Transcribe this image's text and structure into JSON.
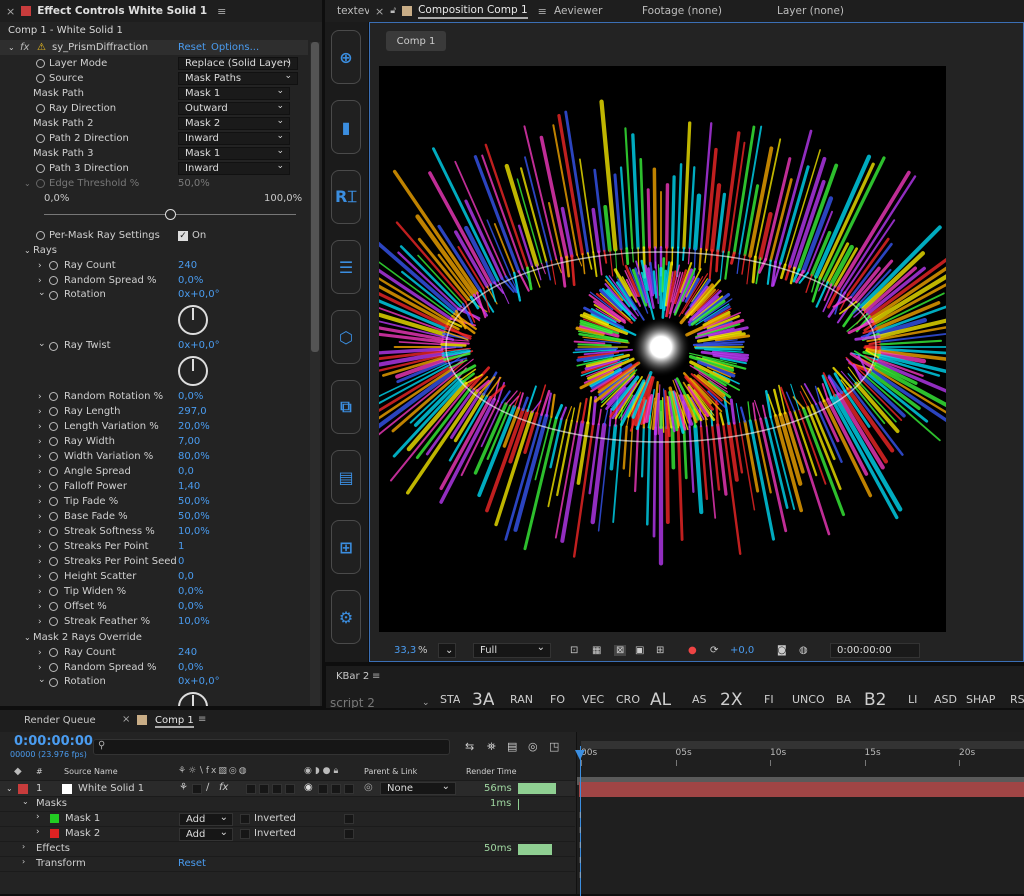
{
  "effect_panel": {
    "tab_title": "Effect Controls White Solid 1",
    "breadcrumb": "Comp 1 - White Solid 1",
    "effect_name": "sy_PrismDiffraction",
    "reset": "Reset",
    "options": "Options...",
    "fx": "fx",
    "rows": [
      {
        "label": "Layer Mode",
        "type": "dd",
        "value": "Replace (Solid Layer)"
      },
      {
        "label": "Source",
        "type": "dd",
        "value": "Mask Paths"
      },
      {
        "label": "Mask Path",
        "type": "dd",
        "value": "Mask 1"
      },
      {
        "label": "Ray Direction",
        "type": "dd",
        "value": "Outward"
      },
      {
        "label": "Mask Path 2",
        "type": "dd",
        "value": "Mask 2"
      },
      {
        "label": "Path 2 Direction",
        "type": "dd",
        "value": "Inward"
      },
      {
        "label": "Mask Path 3",
        "type": "dd",
        "value": "Mask 1"
      },
      {
        "label": "Path 3 Direction",
        "type": "dd",
        "value": "Inward"
      }
    ],
    "edge_threshold": {
      "label": "Edge Threshold %",
      "value": "50,0%",
      "min": "0,0%",
      "max": "100,0%",
      "level": 0.5
    },
    "per_mask": {
      "label": "Per-Mask Ray Settings",
      "value": "On"
    },
    "rays_label": "Rays",
    "rays": [
      {
        "label": "Ray Count",
        "value": "240"
      },
      {
        "label": "Random Spread %",
        "value": "0,0%"
      },
      {
        "label": "Rotation",
        "value": "0x+0,0°"
      },
      {
        "label": "Ray Twist",
        "value": "0x+0,0°"
      },
      {
        "label": "Random Rotation %",
        "value": "0,0%"
      },
      {
        "label": "Ray Length",
        "value": "297,0"
      },
      {
        "label": "Length Variation %",
        "value": "20,0%"
      },
      {
        "label": "Ray Width",
        "value": "7,00"
      },
      {
        "label": "Width Variation %",
        "value": "80,0%"
      },
      {
        "label": "Angle Spread",
        "value": "0,0"
      },
      {
        "label": "Falloff Power",
        "value": "1,40"
      },
      {
        "label": "Tip Fade %",
        "value": "50,0%"
      },
      {
        "label": "Base Fade %",
        "value": "50,0%"
      },
      {
        "label": "Streak Softness %",
        "value": "10,0%"
      },
      {
        "label": "Streaks Per Point",
        "value": "1"
      },
      {
        "label": "Streaks Per Point Seed",
        "value": "0"
      },
      {
        "label": "Height Scatter",
        "value": "0,0"
      },
      {
        "label": "Tip Widen %",
        "value": "0,0%"
      },
      {
        "label": "Offset %",
        "value": "0,0%"
      },
      {
        "label": "Streak Feather %",
        "value": "10,0%"
      }
    ],
    "override_label": "Mask 2 Rays Override",
    "override": [
      {
        "label": "Ray Count",
        "value": "240"
      },
      {
        "label": "Random Spread %",
        "value": "0,0%"
      },
      {
        "label": "Rotation",
        "value": "0x+0,0°"
      }
    ]
  },
  "textev_tab": "textev",
  "kbar_icons": [
    "plus-circle-icon",
    "trash-icon",
    "text-frame-icon",
    "align-lines-icon",
    "cube-icon",
    "duplicate-icon",
    "paste-icon",
    "grid-add-icon",
    "gear-icon"
  ],
  "comp_panel": {
    "tab_title": "Composition Comp 1",
    "tabs": [
      "Aeviewer",
      "Footage (none)",
      "Layer (none)"
    ],
    "comp_button": "Comp 1",
    "zoom": "33,3",
    "zoom_unit": "%",
    "resolution": "Full",
    "exposure": "+0,0",
    "timecode": "0:00:00:00"
  },
  "kbar2": {
    "title": "KBar 2",
    "buttons": [
      "STA",
      "3A",
      "RAN",
      "FO",
      "VEC",
      "CRO",
      "AL",
      "AS",
      "2X",
      "FI",
      "UNCO",
      "BA",
      "B2",
      "LI",
      "ASD",
      "SHAP",
      "RS"
    ],
    "ghost_text": "script 2"
  },
  "timeline": {
    "tabs": [
      "Render Queue",
      "Comp 1"
    ],
    "timecode": "0:00:00:00",
    "fps": "00000 (23.976 fps)",
    "search_placeholder": "",
    "col_source": "Source Name",
    "col_parent": "Parent & Link",
    "col_render": "Render Time",
    "hash": "#",
    "layer": {
      "num": "1",
      "name": "White Solid 1",
      "parent": "None",
      "render": "56ms"
    },
    "masks_label": "Masks",
    "masks_time": "1ms",
    "masks": [
      {
        "name": "Mask 1",
        "mode": "Add",
        "inverted": "Inverted",
        "color": "#22cc22"
      },
      {
        "name": "Mask 2",
        "mode": "Add",
        "inverted": "Inverted",
        "color": "#dd2222"
      }
    ],
    "effects_label": "Effects",
    "effects_time": "50ms",
    "transform_label": "Transform",
    "transform_reset": "Reset",
    "ruler": [
      "00s",
      "05s",
      "10s",
      "15s",
      "20s"
    ]
  }
}
